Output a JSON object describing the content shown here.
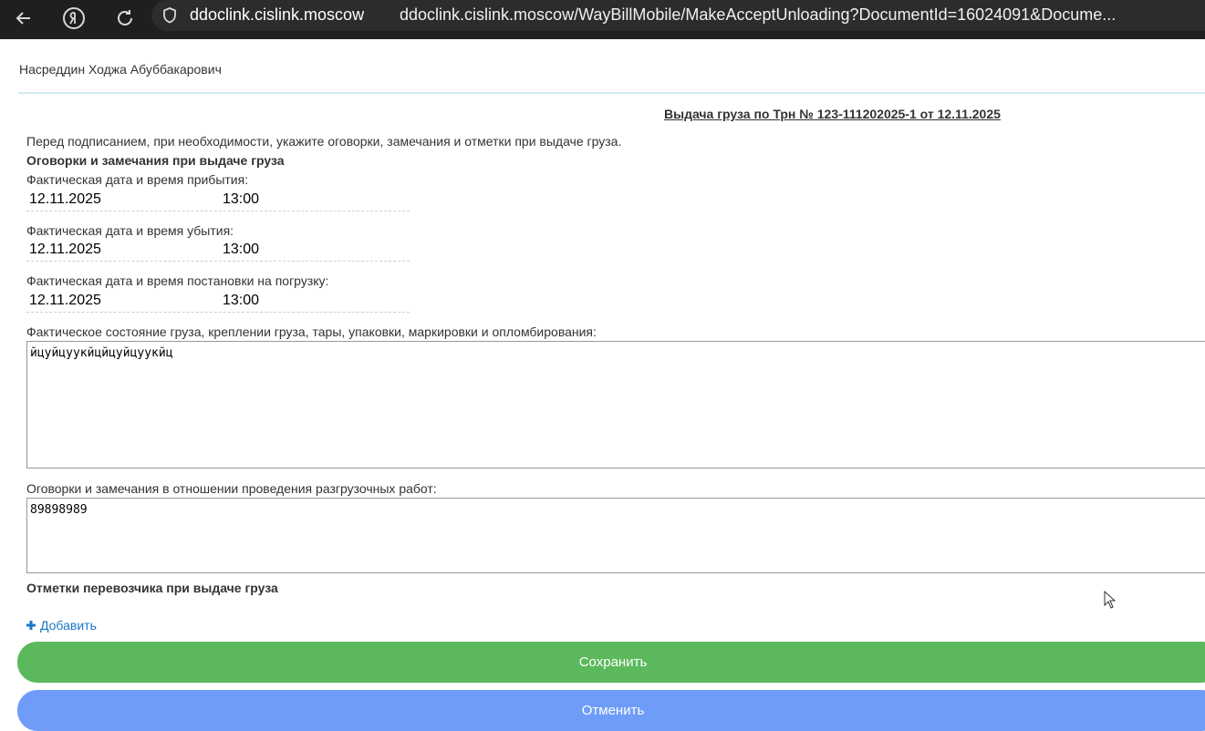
{
  "browser": {
    "domain": "ddoclink.cislink.moscow",
    "url": "ddoclink.cislink.moscow/WayBillMobile/MakeAcceptUnloading?DocumentId=16024091&Docume..."
  },
  "header": {
    "user_name": "Насреддин Ходжа Абуббакарович"
  },
  "document": {
    "title": "Выдача груза по Трн № 123-111202025-1 от 12.11.2025",
    "intro": "Перед подписанием, при необходимости, укажите оговорки, замечания и отметки при выдаче груза."
  },
  "remarks_section": {
    "heading": "Оговорки и замечания при выдаче груза",
    "arrival": {
      "label": "Фактическая дата и время прибытия:",
      "date": "12.11.2025",
      "time": "13:00"
    },
    "departure": {
      "label": "Фактическая дата и время убытия:",
      "date": "12.11.2025",
      "time": "13:00"
    },
    "loading": {
      "label": "Фактическая дата и время постановки на погрузку:",
      "date": "12.11.2025",
      "time": "13:00"
    },
    "cargo_state": {
      "label": "Фактическое состояние груза, креплении груза, тары, упаковки, маркировки и опломбирования:",
      "value": "йцуйцуукйцйцуйцуукйц"
    },
    "unloading_remarks": {
      "label": "Оговорки и замечания в отношении проведения разгрузочных работ:",
      "value": "89898989"
    }
  },
  "carrier_section": {
    "heading": "Отметки перевозчика при выдаче груза",
    "add_label": "Добавить"
  },
  "actions": {
    "save_label": "Сохранить",
    "cancel_label": "Отменить"
  },
  "colors": {
    "save": "#5cb85c",
    "cancel": "#6f9cf8",
    "link": "#1a76c9",
    "browser_bar": "#1f1f1f"
  },
  "icons": [
    "back-icon",
    "yandex-icon",
    "reload-icon",
    "shield-icon",
    "plus-icon",
    "cursor-icon"
  ]
}
